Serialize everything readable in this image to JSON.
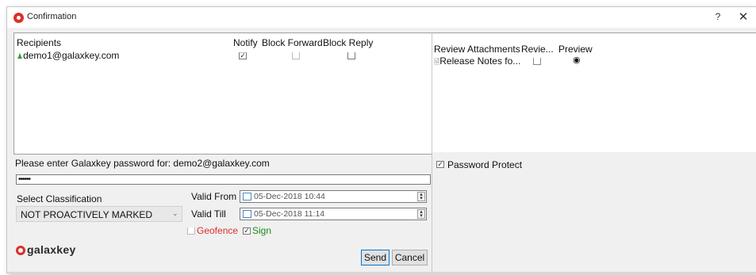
{
  "window": {
    "title": "Confirmation",
    "help": "?",
    "close": "✕"
  },
  "recipients": {
    "headers": {
      "recipients": "Recipients",
      "notify": "Notify",
      "block_forward": "Block Forward",
      "block_reply": "Block Reply"
    },
    "rows": [
      {
        "email": "demo1@galaxkey.com",
        "notify": true,
        "block_forward": false,
        "block_reply": false
      }
    ]
  },
  "attachments": {
    "headers": {
      "review": "Review Attachments",
      "revie": "Revie...",
      "preview": "Preview"
    },
    "rows": [
      {
        "name": "Release Notes fo...",
        "reviewed": false,
        "preview_icon": "eye-icon"
      }
    ]
  },
  "password": {
    "prompt": "Please enter Galaxkey password for: demo2@galaxkey.com",
    "value": "••••••",
    "protect_label": "Password Protect",
    "protect_checked": true
  },
  "classification": {
    "label": "Select Classification",
    "selected": "NOT PROACTIVELY MARKED"
  },
  "validity": {
    "from_label": "Valid From",
    "from_value": "05-Dec-2018 10:44",
    "till_label": "Valid Till",
    "till_value": "05-Dec-2018 11:14"
  },
  "options": {
    "geofence_label": "Geofence",
    "geofence_checked": false,
    "sign_label": "Sign",
    "sign_checked": true,
    "geofence_color": "#d9302c",
    "sign_color": "#1a8a1a"
  },
  "brand": {
    "logo_text": "galaxkey",
    "accent": "#d9302c"
  },
  "buttons": {
    "send": "Send",
    "cancel": "Cancel"
  }
}
